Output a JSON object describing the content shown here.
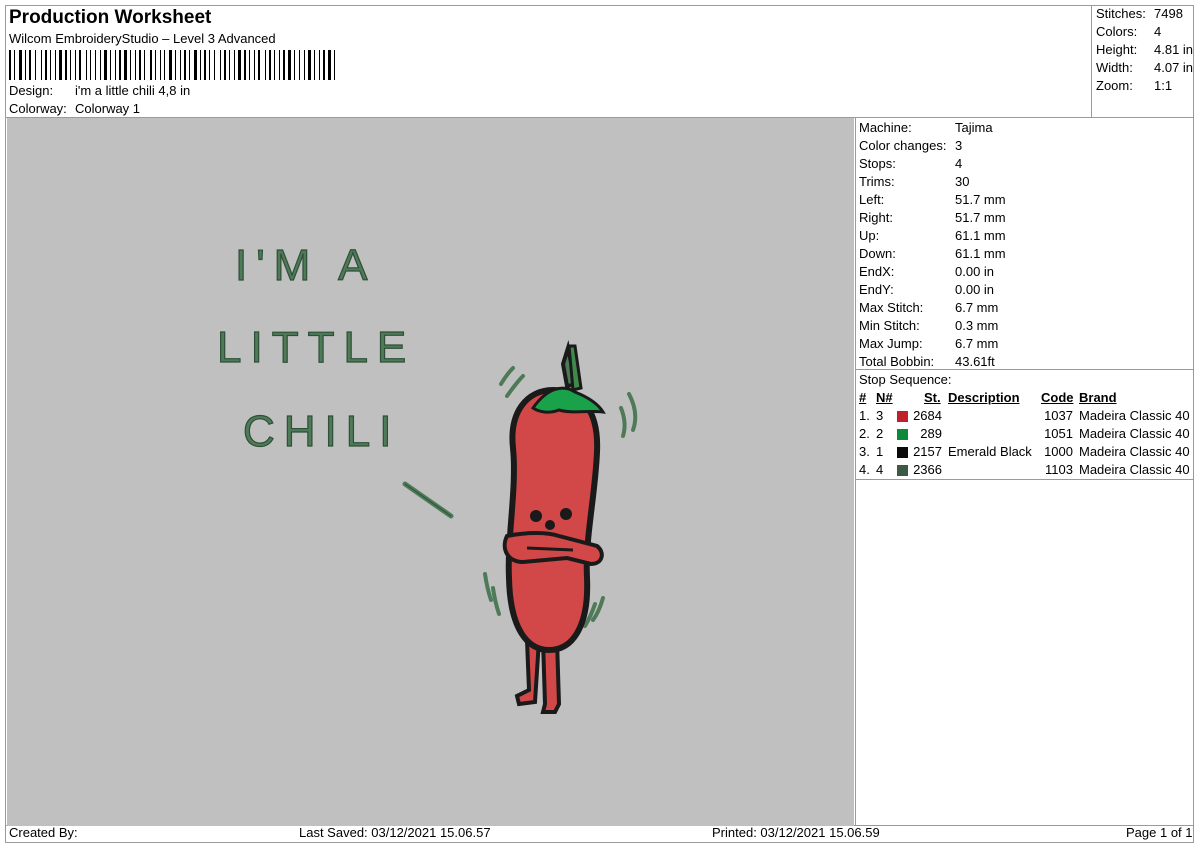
{
  "header": {
    "title": "Production Worksheet",
    "software": "Wilcom EmbroideryStudio – Level 3 Advanced",
    "design_label": "Design:",
    "design_value": "i'm a little chili 4,8 in",
    "colorway_label": "Colorway:",
    "colorway_value": "Colorway 1"
  },
  "summary": [
    {
      "label": "Stitches:",
      "value": "7498"
    },
    {
      "label": "Colors:",
      "value": "4"
    },
    {
      "label": "Height:",
      "value": "4.81 in"
    },
    {
      "label": "Width:",
      "value": "4.07 in"
    },
    {
      "label": "Zoom:",
      "value": "1:1"
    }
  ],
  "design_text": {
    "line1": "I'M A",
    "line2": "LITTLE",
    "line3": "CHILI"
  },
  "machine_info": [
    {
      "label": "Machine:",
      "value": "Tajima"
    },
    {
      "label": "Color changes:",
      "value": "3"
    },
    {
      "label": "Stops:",
      "value": "4"
    },
    {
      "label": "Trims:",
      "value": "30"
    },
    {
      "label": "Left:",
      "value": "51.7 mm"
    },
    {
      "label": "Right:",
      "value": "51.7 mm"
    },
    {
      "label": "Up:",
      "value": "61.1 mm"
    },
    {
      "label": "Down:",
      "value": "61.1 mm"
    },
    {
      "label": "EndX:",
      "value": "0.00 in"
    },
    {
      "label": "EndY:",
      "value": "0.00 in"
    },
    {
      "label": "Max Stitch:",
      "value": "6.7 mm"
    },
    {
      "label": "Min Stitch:",
      "value": "0.3 mm"
    },
    {
      "label": "Max Jump:",
      "value": "6.7 mm"
    },
    {
      "label": "Total Bobbin:",
      "value": "43.61ft"
    }
  ],
  "stops": {
    "title": "Stop Sequence:",
    "columns": {
      "num": "#",
      "needle": "N#",
      "stitches": "St.",
      "description": "Description",
      "code": "Code",
      "brand": "Brand"
    },
    "rows": [
      {
        "num": "1.",
        "needle": "3",
        "color": "#c0202c",
        "stitches": "2684",
        "description": "",
        "code": "1037",
        "brand": "Madeira Classic 40"
      },
      {
        "num": "2.",
        "needle": "2",
        "color": "#0c8a3c",
        "stitches": "289",
        "description": "",
        "code": "1051",
        "brand": "Madeira Classic 40"
      },
      {
        "num": "3.",
        "needle": "1",
        "color": "#0a0a0a",
        "stitches": "2157",
        "description": "Emerald Black",
        "code": "1000",
        "brand": "Madeira Classic 40"
      },
      {
        "num": "4.",
        "needle": "4",
        "color": "#3a5a44",
        "stitches": "2366",
        "description": "",
        "code": "1103",
        "brand": "Madeira Classic 40"
      }
    ]
  },
  "footer": {
    "created_by": "Created By:",
    "last_saved": "Last Saved: 03/12/2021 15.06.57",
    "printed": "Printed: 03/12/2021 15.06.59",
    "page": "Page 1 of 1"
  }
}
